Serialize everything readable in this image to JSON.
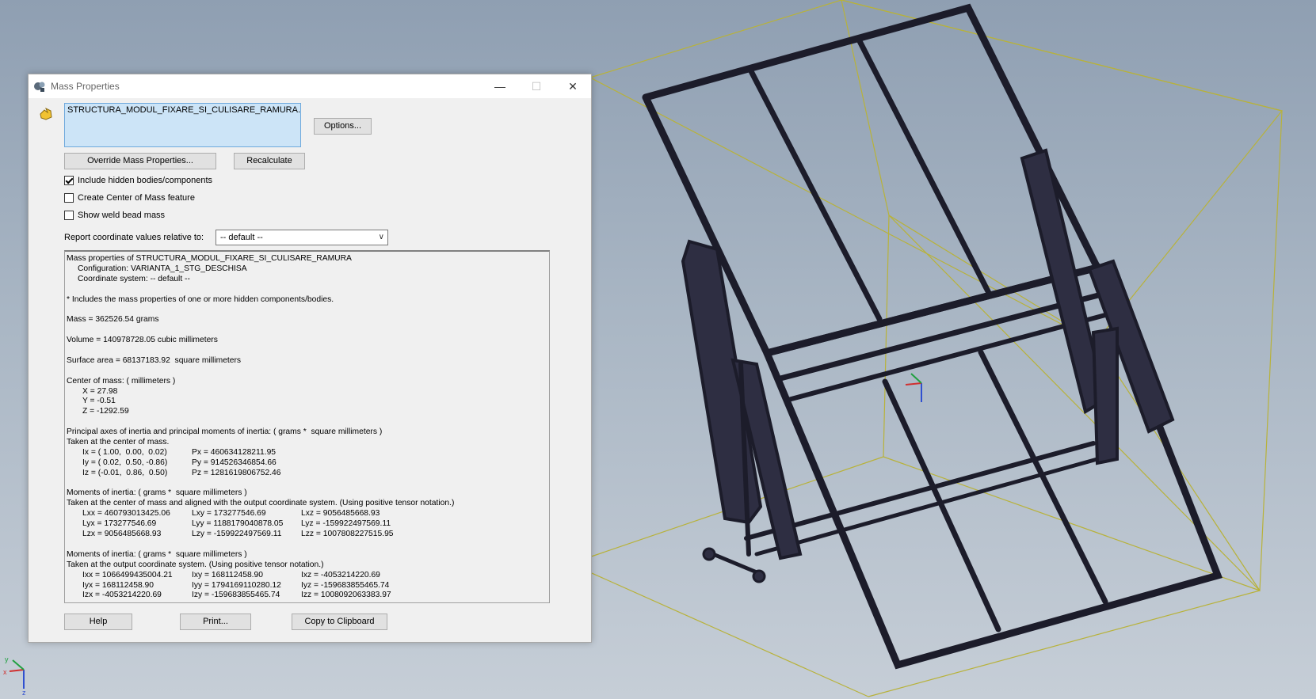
{
  "dialog": {
    "title": "Mass Properties",
    "window_min": "—",
    "window_max": "☐",
    "window_close": "✕",
    "file_name": "STRUCTURA_MODUL_FIXARE_SI_CULISARE_RAMURA.SLDASM",
    "options_label": "Options...",
    "override_label": "Override Mass Properties...",
    "recalculate_label": "Recalculate",
    "include_hidden_label": "Include hidden bodies/components",
    "include_hidden_checked": true,
    "create_com_label": "Create Center of Mass feature",
    "create_com_checked": false,
    "show_weld_label": "Show weld bead mass",
    "show_weld_checked": false,
    "report_label": "Report coordinate values relative to:",
    "coord_system_value": "-- default --",
    "help_label": "Help",
    "print_label": "Print...",
    "copy_label": "Copy to Clipboard"
  },
  "results": {
    "header": "Mass properties of STRUCTURA_MODUL_FIXARE_SI_CULISARE_RAMURA",
    "configuration": "Configuration: VARIANTA_1_STG_DESCHISA",
    "coordinate_system": "Coordinate system: -- default --",
    "hidden_note": "* Includes the mass properties of one or more hidden components/bodies.",
    "mass": "Mass = 362526.54 grams",
    "volume": "Volume = 140978728.05 cubic millimeters",
    "surface_area": "Surface area = 68137183.92  square millimeters",
    "com_header": "Center of mass: ( millimeters )",
    "com_x": "X = 27.98",
    "com_y": "Y = -0.51",
    "com_z": "Z = -1292.59",
    "principal_header": "Principal axes of inertia and principal moments of inertia: ( grams *  square millimeters )",
    "principal_taken": "Taken at the center of mass.",
    "ix": "Ix = ( 1.00,  0.00,  0.02)",
    "px": "Px = 460634128211.95",
    "iy": "Iy = ( 0.02,  0.50, -0.86)",
    "py": "Py = 914526346854.66",
    "iz": "Iz = (-0.01,  0.86,  0.50)",
    "pz": "Pz = 1281619806752.46",
    "moi1_header": "Moments of inertia: ( grams *  square millimeters )",
    "moi1_taken": "Taken at the center of mass and aligned with the output coordinate system. (Using positive tensor notation.)",
    "lxx": "Lxx = 460793013425.06",
    "lxy": "Lxy = 173277546.69",
    "lxz": "Lxz = 9056485668.93",
    "lyx": "Lyx = 173277546.69",
    "lyy": "Lyy = 1188179040878.05",
    "lyz": "Lyz = -159922497569.11",
    "lzx": "Lzx = 9056485668.93",
    "lzy": "Lzy = -159922497569.11",
    "lzz": "Lzz = 1007808227515.95",
    "moi2_header": "Moments of inertia: ( grams *  square millimeters )",
    "moi2_taken": "Taken at the output coordinate system. (Using positive tensor notation.)",
    "ixx": "Ixx = 1066499435004.21",
    "ixy": "Ixy = 168112458.90",
    "ixz": "Ixz = -4053214220.69",
    "iyx": "Iyx = 168112458.90",
    "iyy": "Iyy = 1794169110280.12",
    "iyz": "Iyz = -159683855465.74",
    "izx": "Izx = -4053214220.69",
    "izy": "Izy = -159683855465.74",
    "izz": "Izz = 1008092063383.97"
  },
  "colors": {
    "frame": "#1c1c2a",
    "bounding_box": "#b8b23a",
    "selection_blue": "#cce4f7"
  }
}
